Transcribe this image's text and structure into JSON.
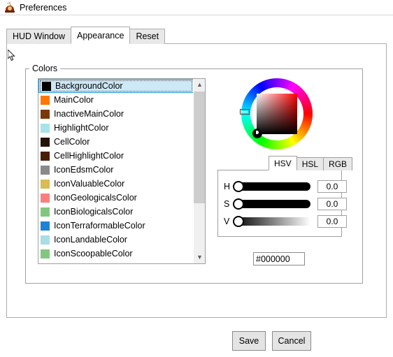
{
  "window": {
    "title": "Preferences",
    "icon": "app-bell-icon"
  },
  "tabs": [
    {
      "label": "HUD Window",
      "active": false
    },
    {
      "label": "Appearance",
      "active": true
    },
    {
      "label": "Reset",
      "active": false
    }
  ],
  "colors_group": {
    "label": "Colors",
    "items": [
      {
        "name": "BackgroundColor",
        "swatch": "#000000",
        "selected": true
      },
      {
        "name": "MainColor",
        "swatch": "#ff7700",
        "selected": false
      },
      {
        "name": "InactiveMainColor",
        "swatch": "#7a3708",
        "selected": false
      },
      {
        "name": "HighlightColor",
        "swatch": "#a7e3e8",
        "selected": false
      },
      {
        "name": "CellColor",
        "swatch": "#241206",
        "selected": false
      },
      {
        "name": "CellHighlightColor",
        "swatch": "#4a1d05",
        "selected": false
      },
      {
        "name": "IconEdsmColor",
        "swatch": "#8a8a8a",
        "selected": false
      },
      {
        "name": "IconValuableColor",
        "swatch": "#d9bc52",
        "selected": false
      },
      {
        "name": "IconGeologicalsColor",
        "swatch": "#fb7f7f",
        "selected": false
      },
      {
        "name": "IconBiologicalsColor",
        "swatch": "#81c87e",
        "selected": false
      },
      {
        "name": "IconTerraformableColor",
        "swatch": "#1e82d6",
        "selected": false
      },
      {
        "name": "IconLandableColor",
        "swatch": "#a7dde4",
        "selected": false
      },
      {
        "name": "IconScoopableColor",
        "swatch": "#81c87e",
        "selected": false
      }
    ],
    "scrollbar": {
      "up_arrow": "chevron-up-icon",
      "down_arrow": "chevron-down-icon"
    }
  },
  "picker": {
    "wheel": {
      "hue_marker_label": "hue-marker",
      "sv_marker_label": "saturation-value-marker"
    },
    "mode_tabs": [
      {
        "label": "HSV",
        "active": true
      },
      {
        "label": "HSL",
        "active": false
      },
      {
        "label": "RGB",
        "active": false
      }
    ],
    "sliders": [
      {
        "label": "H",
        "value": "0.0"
      },
      {
        "label": "S",
        "value": "0.0"
      },
      {
        "label": "V",
        "value": "0.0"
      }
    ],
    "hex": "#000000"
  },
  "footer": {
    "save_label": "Save",
    "cancel_label": "Cancel"
  }
}
